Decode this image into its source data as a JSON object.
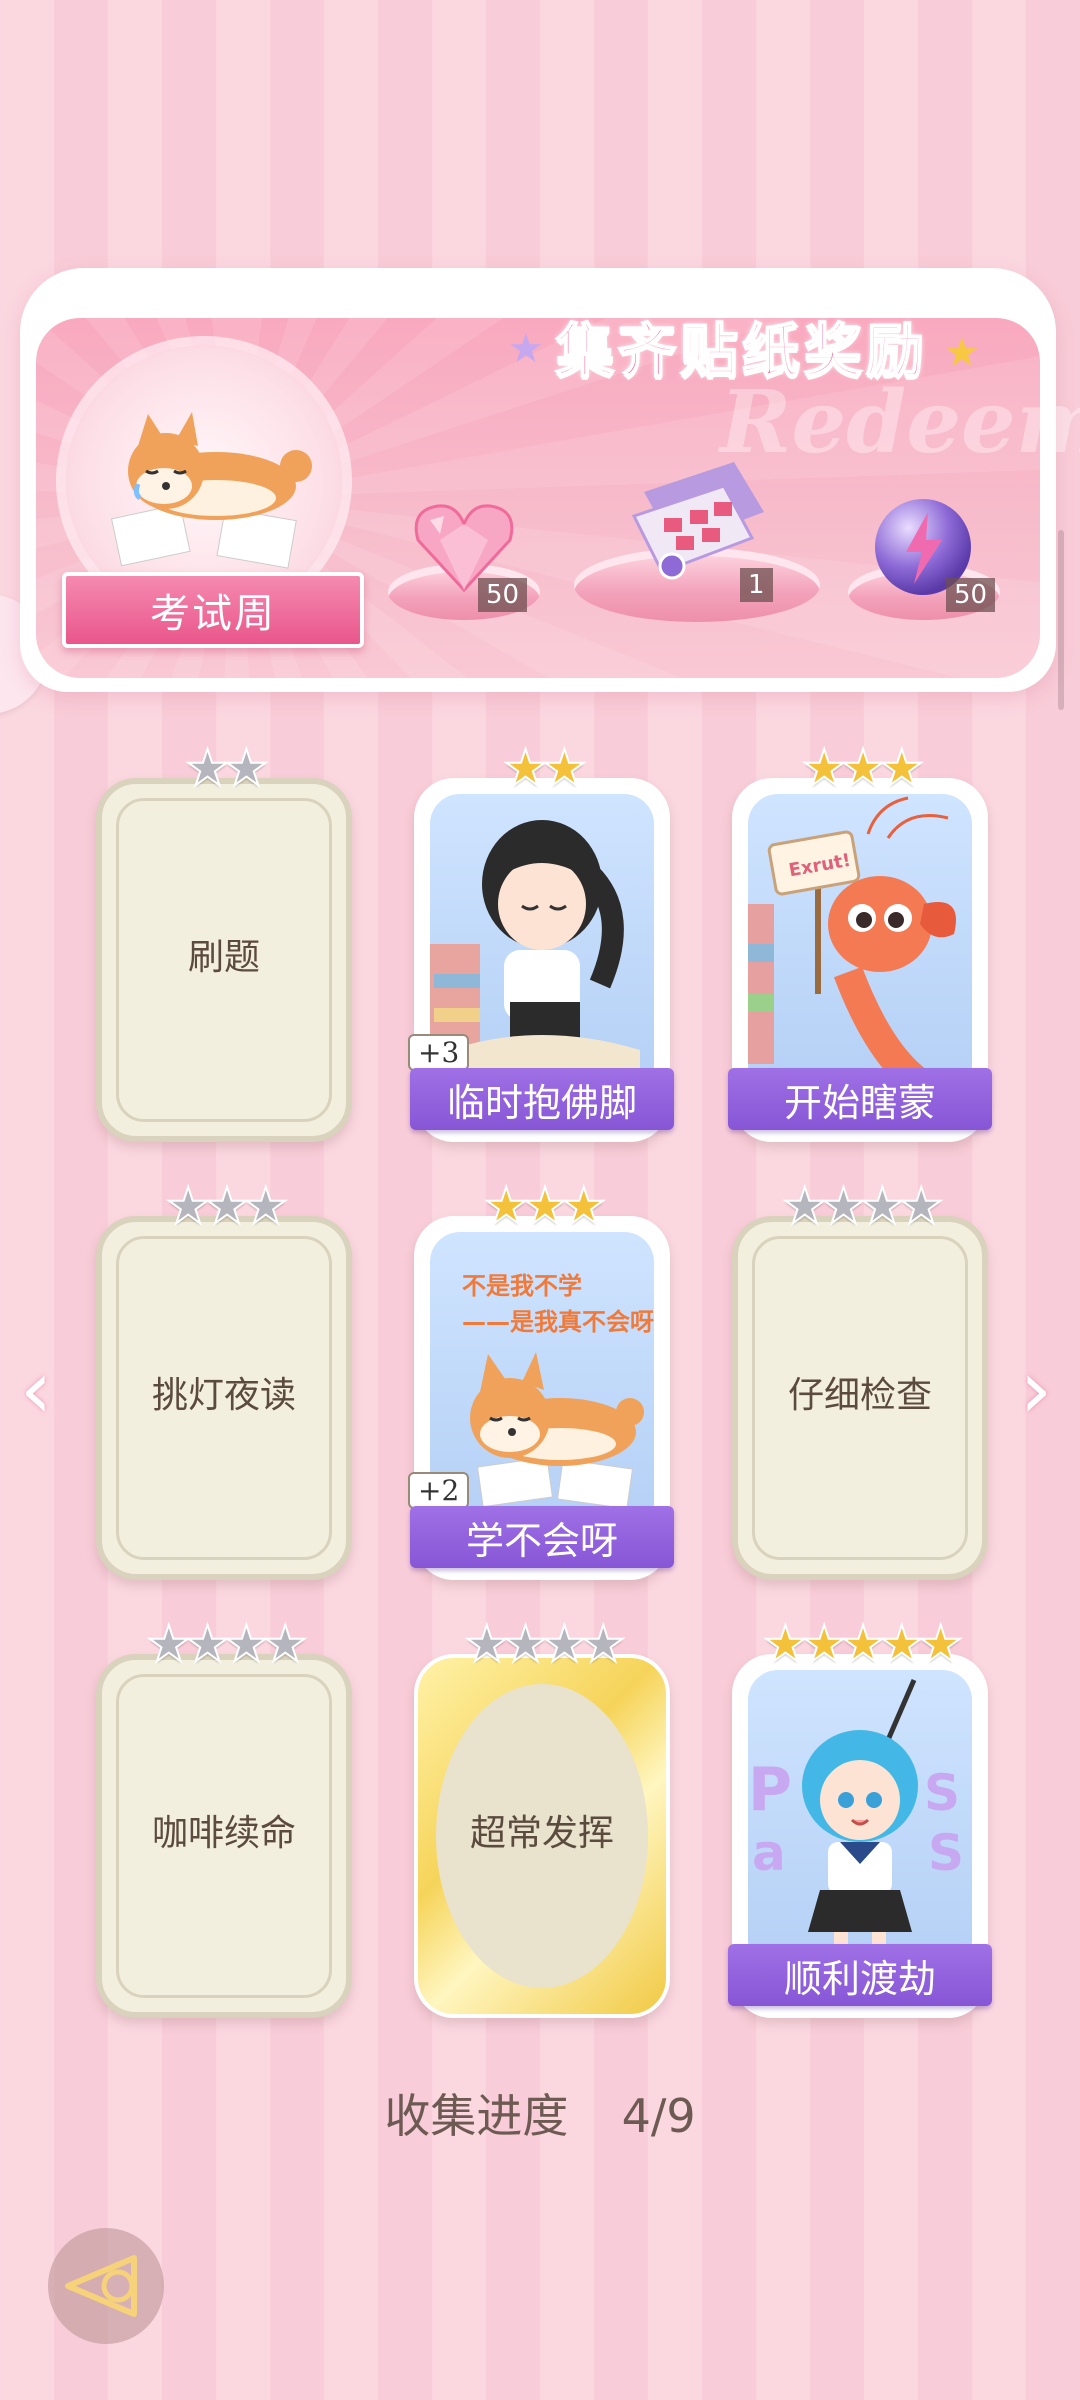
{
  "banner": {
    "title": "集齐贴纸奖励",
    "watermark": "Redeem",
    "theme_label": "考试周",
    "rewards": [
      {
        "icon": "pink-heart-gem-icon",
        "count": "50"
      },
      {
        "icon": "gift-box-icon",
        "count": "1"
      },
      {
        "icon": "purple-lightning-orb-icon",
        "count": "50"
      }
    ]
  },
  "cards": [
    {
      "label": "刷题",
      "stars": 2,
      "star_color": "silver",
      "owned": false,
      "style": "blank"
    },
    {
      "label": "临时抱佛脚",
      "stars": 2,
      "star_color": "gold",
      "owned": true,
      "extra": "+3",
      "art": "girl-reading-art"
    },
    {
      "label": "开始瞎蒙",
      "stars": 3,
      "star_color": "gold",
      "owned": true,
      "art": "shrimp-sign-art",
      "art_sign": "Exrut!"
    },
    {
      "label": "挑灯夜读",
      "stars": 3,
      "star_color": "silver",
      "owned": false,
      "style": "blank"
    },
    {
      "label": "学不会呀",
      "stars": 3,
      "star_color": "gold",
      "owned": true,
      "extra": "+2",
      "art": "sleepy-shiba-art",
      "art_text": [
        "不是我不学",
        "——是我真不会呀"
      ]
    },
    {
      "label": "仔细检查",
      "stars": 4,
      "star_color": "silver",
      "owned": false,
      "style": "blank"
    },
    {
      "label": "咖啡续命",
      "stars": 4,
      "star_color": "silver",
      "owned": false,
      "style": "blank"
    },
    {
      "label": "超常发挥",
      "stars": 4,
      "star_color": "silver",
      "owned": false,
      "style": "gold"
    },
    {
      "label": "顺利渡劫",
      "stars": 5,
      "star_color": "gold",
      "owned": true,
      "art": "blue-hair-girl-art"
    }
  ],
  "progress": {
    "label": "收集进度",
    "value": "4/9"
  },
  "colors": {
    "accent": "#f25f8e",
    "label_bar": "#8c5cdc",
    "background": "#fbd7e0"
  }
}
